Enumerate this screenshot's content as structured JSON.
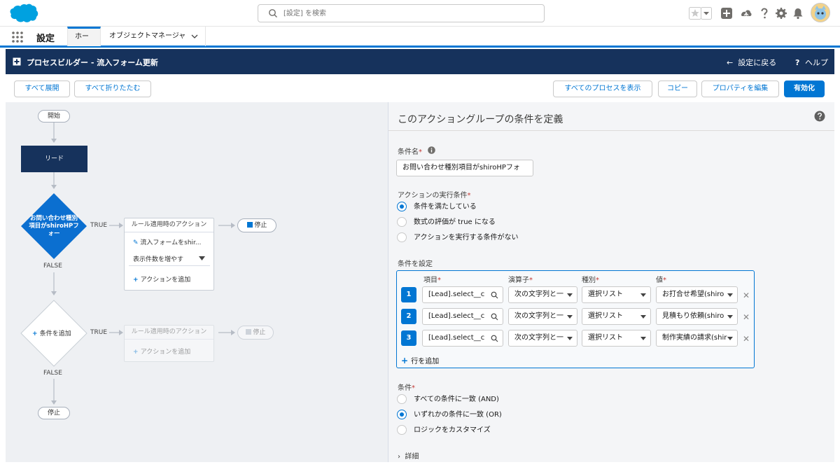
{
  "search": {
    "placeholder": "[設定] を検索"
  },
  "app": {
    "name": "設定",
    "tabs": [
      "ホーム",
      "オブジェクトマネージャ"
    ]
  },
  "builder": {
    "title": "プロセスビルダー - 流入フォーム更新",
    "back": "設定に戻る",
    "help": "ヘルプ"
  },
  "toolbar": {
    "expand_all": "すべて展開",
    "collapse_all": "すべて折りたたむ",
    "show_all": "すべてのプロセスを表示",
    "copy": "コピー",
    "edit_props": "プロパティを編集",
    "activate": "有効化"
  },
  "canvas": {
    "start": "開始",
    "object": "リード",
    "criteria1": "お問い合わせ種別項目がshiroHPフォー",
    "true_label": "TRUE",
    "false_label": "FALSE",
    "immediate_actions": "ルール適用時のアクション",
    "action1": "流入フォームをshir...",
    "show_more": "表示件数を増やす",
    "add_action": "アクションを追加",
    "stop": "停止",
    "add_criteria": "条件を追加"
  },
  "panel": {
    "title": "このアクショングループの条件を定義",
    "name_label": "条件名",
    "name_value": "お問い合わせ種別項目がshiroHPフォ",
    "exec_label": "アクションの実行条件",
    "exec_options": [
      "条件を満たしている",
      "数式の評価が true になる",
      "アクションを実行する条件がない"
    ],
    "exec_selected": 0,
    "set_cond_label": "条件を設定",
    "columns": {
      "field": "項目",
      "operator": "演算子",
      "type": "種別",
      "value": "値"
    },
    "rows": [
      {
        "num": "1",
        "field": "[Lead].select__c",
        "operator": "次の文字列と一",
        "type": "選択リスト",
        "value": "お打合せ希望(shiro"
      },
      {
        "num": "2",
        "field": "[Lead].select__c",
        "operator": "次の文字列と一",
        "type": "選択リスト",
        "value": "見積もり依頼(shiro"
      },
      {
        "num": "3",
        "field": "[Lead].select__c",
        "operator": "次の文字列と一",
        "type": "選択リスト",
        "value": "制作実績の請求(shir"
      }
    ],
    "add_row": "行を追加",
    "cond_label": "条件",
    "cond_options": [
      "すべての条件に一致 (AND)",
      "いずれかの条件に一致 (OR)",
      "ロジックをカスタマイズ"
    ],
    "cond_selected": 1,
    "details": "詳細"
  },
  "colors": {
    "brand": "#0176d3",
    "navy": "#16325c",
    "criteria": "#0b6fd0"
  }
}
